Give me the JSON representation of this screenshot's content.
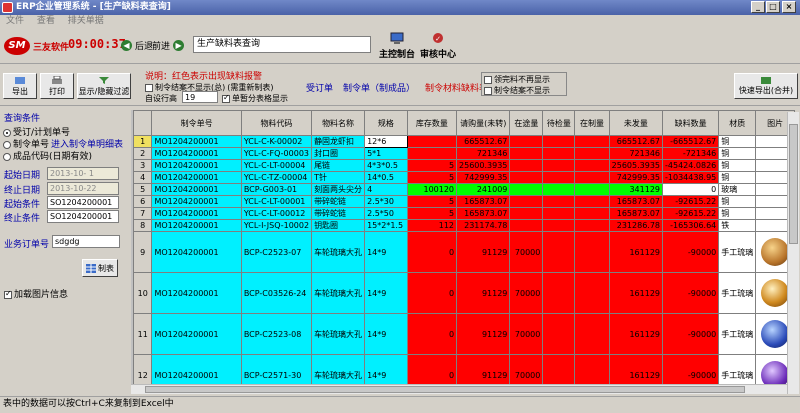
{
  "window": {
    "title": "ERP企业管理系统 - [生产缺料表查询]",
    "min": "_",
    "max": "□",
    "close": "×"
  },
  "menu": [
    "文件",
    "查看",
    "排关单据"
  ],
  "nav": {
    "logo": "SM",
    "brand": "三友软件",
    "clock": "09:00:37",
    "back": "后退",
    "forward": "前进",
    "current": "生产缺料表查询",
    "main_console": "主控制台",
    "audit_center": "审核中心"
  },
  "toolbar": {
    "export": "导出",
    "print": "打印",
    "show_filter": "显示/隐藏过滤",
    "hint": "说明：红色表示出现缺料报警",
    "chk_end_hide": "制令结案不显示(总)",
    "chk_need_print": "(需重新制表)",
    "auto_rows_label": "自设行高",
    "auto_rows_value": "19",
    "chk_single": "单暂分表格显示",
    "tabs": [
      "受订单",
      "制令单（制成品）",
      "制令材料缺料表"
    ],
    "chk_done": "领完料不再显示",
    "chk_order_end": "制令结案不显示",
    "quick_export": "快速导出(合并)"
  },
  "left": {
    "section": "查询条件",
    "radio": [
      "受订/计划单号",
      "制令单号",
      "成品代码(日期有效)"
    ],
    "goto": "进入制令单明细表",
    "start_date_label": "起始日期",
    "start_date": "2013-10- 1",
    "end_date_label": "终止日期",
    "end_date": "2013-10-22",
    "start_cond_label": "起始条件",
    "start_cond": "SO1204200001",
    "end_cond_label": "终止条件",
    "end_cond": "SO1204200001",
    "order_label": "业务订单号",
    "order": "sdgdg",
    "make_table": "制表",
    "load_img": "加载图片信息"
  },
  "grid": {
    "headers": [
      "制令单号",
      "物料代码",
      "物料名称",
      "规格",
      "库存数量",
      "请购量(未转)",
      "在途量",
      "待检量",
      "在制量",
      "未发量",
      "缺料数量",
      "材质",
      "图片"
    ],
    "rows": [
      [
        "1",
        "MO1204200001",
        "YCL-C-K-00002",
        "静固龙虾扣",
        "12*6",
        "",
        "665512.67",
        "",
        "",
        "",
        "665512.67",
        "-665512.67",
        "铜"
      ],
      [
        "2",
        "MO1204200001",
        "YCL-C-FQ-00003",
        "封口圈",
        "5*1",
        "",
        "721346",
        "",
        "",
        "",
        "721346",
        "-721346",
        "铜"
      ],
      [
        "3",
        "MO1204200001",
        "YCL-C-LT-00004",
        "尾链",
        "4*3*0.5",
        "5",
        "25600.3935",
        "",
        "",
        "",
        "25605.3935",
        "-45424.0826",
        "铜"
      ],
      [
        "4",
        "MO1204200001",
        "YCL-C-TZ-00004",
        "T针",
        "14*0.5",
        "5",
        "742999.35",
        "",
        "",
        "",
        "742999.35",
        "-1034438.95",
        "铜"
      ],
      [
        "5",
        "MO1204200001",
        "BCP-G003-01",
        "刻面两头尖分",
        "4",
        "100120",
        "241009",
        "",
        "",
        "",
        "341129",
        "0",
        "玻璃"
      ],
      [
        "6",
        "MO1204200001",
        "YCL-C-LT-00001",
        "带碎蛇链",
        "2.5*30",
        "5",
        "165873.07",
        "",
        "",
        "",
        "165873.07",
        "-92615.22",
        "铜"
      ],
      [
        "7",
        "MO1204200001",
        "YCL-C-LT-00012",
        "带碎蛇链",
        "2.5*50",
        "5",
        "165873.07",
        "",
        "",
        "",
        "165873.07",
        "-92615.22",
        "铜"
      ],
      [
        "8",
        "MO1204200001",
        "YCL-I-JSQ-10002",
        "钥匙圈",
        "15*2*1.5",
        "112",
        "231174.78",
        "",
        "",
        "",
        "231286.78",
        "-165306.64",
        "铁"
      ],
      [
        "9",
        "MO1204200001",
        "BCP-C2523-07",
        "车轮琉璃大孔",
        "14*9",
        "0",
        "91129",
        "70000",
        "",
        "",
        "161129",
        "-90000",
        "手工琉璃"
      ],
      [
        "10",
        "MO1204200001",
        "BCP-C03526-24",
        "车轮琉璃大孔",
        "14*9",
        "0",
        "91129",
        "70000",
        "",
        "",
        "161129",
        "-90000",
        "手工琉璃"
      ],
      [
        "11",
        "MO1204200001",
        "BCP-C2523-08",
        "车轮琉璃大孔",
        "14*9",
        "0",
        "91129",
        "70000",
        "",
        "",
        "161129",
        "-90000",
        "手工琉璃"
      ],
      [
        "12",
        "MO1204200001",
        "BCP-C2571-30",
        "车轮琉璃大孔",
        "14*9",
        "0",
        "91129",
        "70000",
        "",
        "",
        "161129",
        "-90000",
        "手工琉璃"
      ]
    ]
  },
  "status": "表中的数据可以按Ctrl+C来复制到Excel中",
  "colors": {
    "cyan": "#00f0ff",
    "red": "#ff0000",
    "green": "#00ff00",
    "title": "#4a62a8"
  },
  "icons": [
    "search-icon",
    "print-icon",
    "filter-icon",
    "export-icon",
    "console-icon",
    "audit-icon",
    "back-arrow-icon",
    "forward-arrow-icon"
  ]
}
